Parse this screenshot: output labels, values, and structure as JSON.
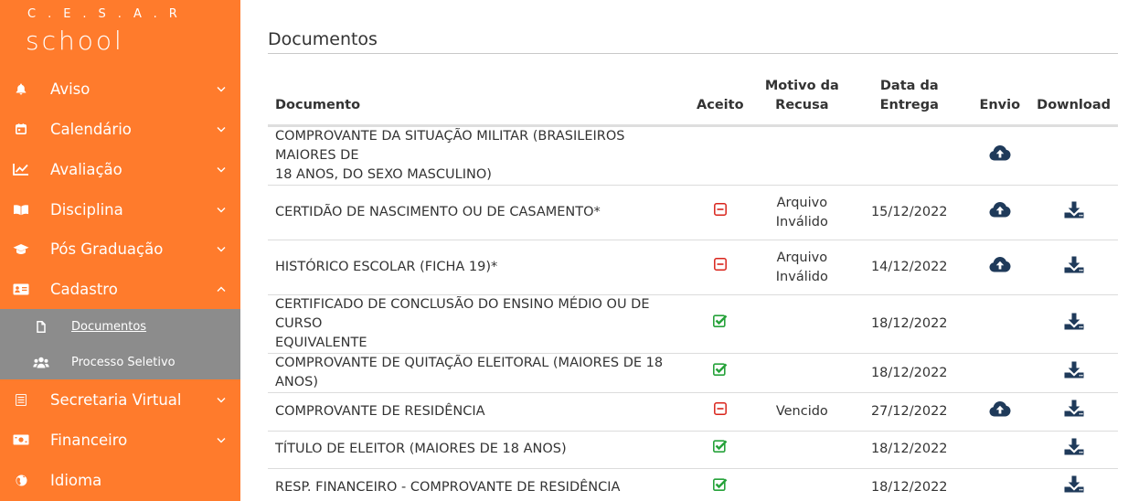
{
  "brand": {
    "logo_top": "C.E.S.A.R",
    "logo_bottom": "school"
  },
  "colors": {
    "sidebar": "#ff7b2c",
    "submenu": "#8c8c8c",
    "refused": "#d9241b",
    "accepted": "#26a23a",
    "icon_dark": "#1f3a5a"
  },
  "sidebar": {
    "items": [
      {
        "label": "Aviso",
        "icon": "bell-icon",
        "expanded": false
      },
      {
        "label": "Calendário",
        "icon": "calendar-icon",
        "expanded": false
      },
      {
        "label": "Avaliação",
        "icon": "chart-line-icon",
        "expanded": false
      },
      {
        "label": "Disciplina",
        "icon": "book-open-icon",
        "expanded": false
      },
      {
        "label": "Pós Graduação",
        "icon": "graduation-cap-icon",
        "expanded": false
      },
      {
        "label": "Cadastro",
        "icon": "id-card-icon",
        "expanded": true
      },
      {
        "label": "Secretaria Virtual",
        "icon": "list-icon",
        "expanded": false
      },
      {
        "label": "Financeiro",
        "icon": "money-icon",
        "expanded": false
      },
      {
        "label": "Idioma",
        "icon": "globe-icon",
        "expanded": false
      }
    ],
    "submenu": [
      {
        "label": "Documentos",
        "icon": "file-icon",
        "active": true
      },
      {
        "label": "Processo Seletivo",
        "icon": "users-icon",
        "active": false
      }
    ]
  },
  "main": {
    "title": "Documentos",
    "table": {
      "headers": {
        "documento": "Documento",
        "aceito": "Aceito",
        "motivo_1": "Motivo da",
        "motivo_2": "Recusa",
        "data_1": "Data da",
        "data_2": "Entrega",
        "envio": "Envio",
        "download": "Download"
      },
      "rows": [
        {
          "doc_1": "COMPROVANTE DA SITUAÇÃO MILITAR (BRASILEIROS MAIORES DE",
          "doc_2": "18 ANOS, DO SEXO MASCULINO)",
          "status": "none",
          "reason_1": "",
          "reason_2": "",
          "date": "",
          "upload": true,
          "download": false
        },
        {
          "doc_1": "CERTIDÃO DE NASCIMENTO OU DE CASAMENTO*",
          "doc_2": "",
          "status": "refused",
          "reason_1": "Arquivo",
          "reason_2": "Inválido",
          "date": "15/12/2022",
          "upload": true,
          "download": true
        },
        {
          "doc_1": "HISTÓRICO ESCOLAR (FICHA 19)*",
          "doc_2": "",
          "status": "refused",
          "reason_1": "Arquivo",
          "reason_2": "Inválido",
          "date": "14/12/2022",
          "upload": true,
          "download": true
        },
        {
          "doc_1": "CERTIFICADO DE CONCLUSÃO DO ENSINO MÉDIO OU DE CURSO",
          "doc_2": "EQUIVALENTE",
          "status": "accepted",
          "reason_1": "",
          "reason_2": "",
          "date": "18/12/2022",
          "upload": false,
          "download": true
        },
        {
          "doc_1": "COMPROVANTE DE QUITAÇÃO ELEITORAL (MAIORES DE 18 ANOS)",
          "doc_2": "",
          "status": "accepted",
          "reason_1": "",
          "reason_2": "",
          "date": "18/12/2022",
          "upload": false,
          "download": true
        },
        {
          "doc_1": "COMPROVANTE DE RESIDÊNCIA",
          "doc_2": "",
          "status": "refused",
          "reason_1": "Vencido",
          "reason_2": "",
          "date": "27/12/2022",
          "upload": true,
          "download": true
        },
        {
          "doc_1": "TÍTULO DE ELEITOR (MAIORES DE 18 ANOS)",
          "doc_2": "",
          "status": "accepted",
          "reason_1": "",
          "reason_2": "",
          "date": "18/12/2022",
          "upload": false,
          "download": true
        },
        {
          "doc_1": "RESP. FINANCEIRO - COMPROVANTE DE RESIDÊNCIA",
          "doc_2": "",
          "status": "accepted",
          "reason_1": "",
          "reason_2": "",
          "date": "18/12/2022",
          "upload": false,
          "download": true
        }
      ]
    }
  }
}
